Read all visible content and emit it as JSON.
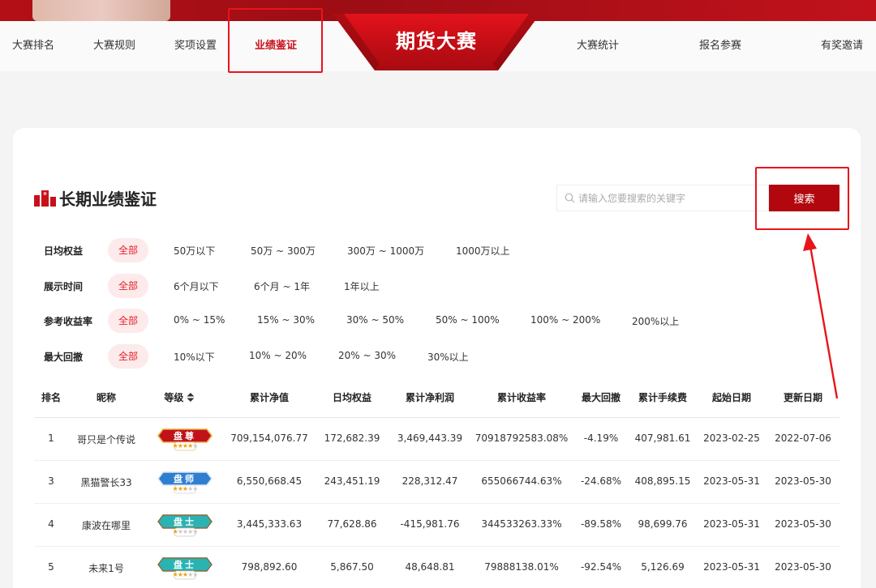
{
  "nav": {
    "items": [
      {
        "label": "大赛排名",
        "active": false
      },
      {
        "label": "大赛规则",
        "active": false
      },
      {
        "label": "奖项设置",
        "active": false
      },
      {
        "label": "业绩鉴证",
        "active": true
      },
      {
        "label": "大赛统计",
        "active": false
      },
      {
        "label": "报名参赛",
        "active": false
      },
      {
        "label": "有奖邀请",
        "active": false
      }
    ],
    "logo": "期货大赛"
  },
  "section": {
    "title": "长期业绩鉴证"
  },
  "search": {
    "placeholder": "请输入您要搜索的关键字",
    "value": "",
    "button_label": "搜索"
  },
  "filters": [
    {
      "label": "日均权益",
      "options": [
        "全部",
        "50万以下",
        "50万 ~ 300万",
        "300万 ~ 1000万",
        "1000万以上"
      ],
      "selected": 0
    },
    {
      "label": "展示时间",
      "options": [
        "全部",
        "6个月以下",
        "6个月 ~ 1年",
        "1年以上"
      ],
      "selected": 0
    },
    {
      "label": "参考收益率",
      "options": [
        "全部",
        "0% ~ 15%",
        "15% ~ 30%",
        "30% ~ 50%",
        "50% ~ 100%",
        "100% ~ 200%",
        "200%以上"
      ],
      "selected": 0
    },
    {
      "label": "最大回撤",
      "options": [
        "全部",
        "10%以下",
        "10% ~ 20%",
        "20% ~ 30%",
        "30%以上"
      ],
      "selected": 0
    }
  ],
  "table": {
    "columns": [
      "排名",
      "昵称",
      "等级",
      "累计净值",
      "日均权益",
      "累计净利润",
      "累计收益率",
      "最大回撤",
      "累计手续费",
      "起始日期",
      "更新日期"
    ],
    "rows": [
      {
        "rank": "1",
        "nickname": "哥只是个传说",
        "level": "盘尊",
        "level_color": "#c1121c",
        "stars": 4,
        "nav": "709,154,076.77",
        "avg_equity": "172,682.39",
        "net_profit": "3,469,443.39",
        "return_rate": "70918792583.08%",
        "max_drawdown": "-4.19%",
        "fees": "407,981.61",
        "start_date": "2023-02-25",
        "update_date": "2022-07-06"
      },
      {
        "rank": "3",
        "nickname": "黑猫警长33",
        "level": "盘师",
        "level_color": "#2f7fd1",
        "stars": 3,
        "nav": "6,550,668.45",
        "avg_equity": "243,451.19",
        "net_profit": "228,312.47",
        "return_rate": "655066744.63%",
        "max_drawdown": "-24.68%",
        "fees": "408,895.15",
        "start_date": "2023-05-31",
        "update_date": "2023-05-30"
      },
      {
        "rank": "4",
        "nickname": "康波在哪里",
        "level": "盘士",
        "level_color": "#2bb3b3",
        "stars": 1,
        "nav": "3,445,333.63",
        "avg_equity": "77,628.86",
        "net_profit": "-415,981.76",
        "return_rate": "344533263.33%",
        "max_drawdown": "-89.58%",
        "fees": "98,699.76",
        "start_date": "2023-05-31",
        "update_date": "2023-05-30"
      },
      {
        "rank": "5",
        "nickname": "未来1号",
        "level": "盘士",
        "level_color": "#2bb3b3",
        "stars": 3,
        "nav": "798,892.60",
        "avg_equity": "5,867.50",
        "net_profit": "48,648.81",
        "return_rate": "79888138.01%",
        "max_drawdown": "-92.54%",
        "fees": "5,126.69",
        "start_date": "2023-05-31",
        "update_date": "2023-05-30"
      }
    ]
  }
}
